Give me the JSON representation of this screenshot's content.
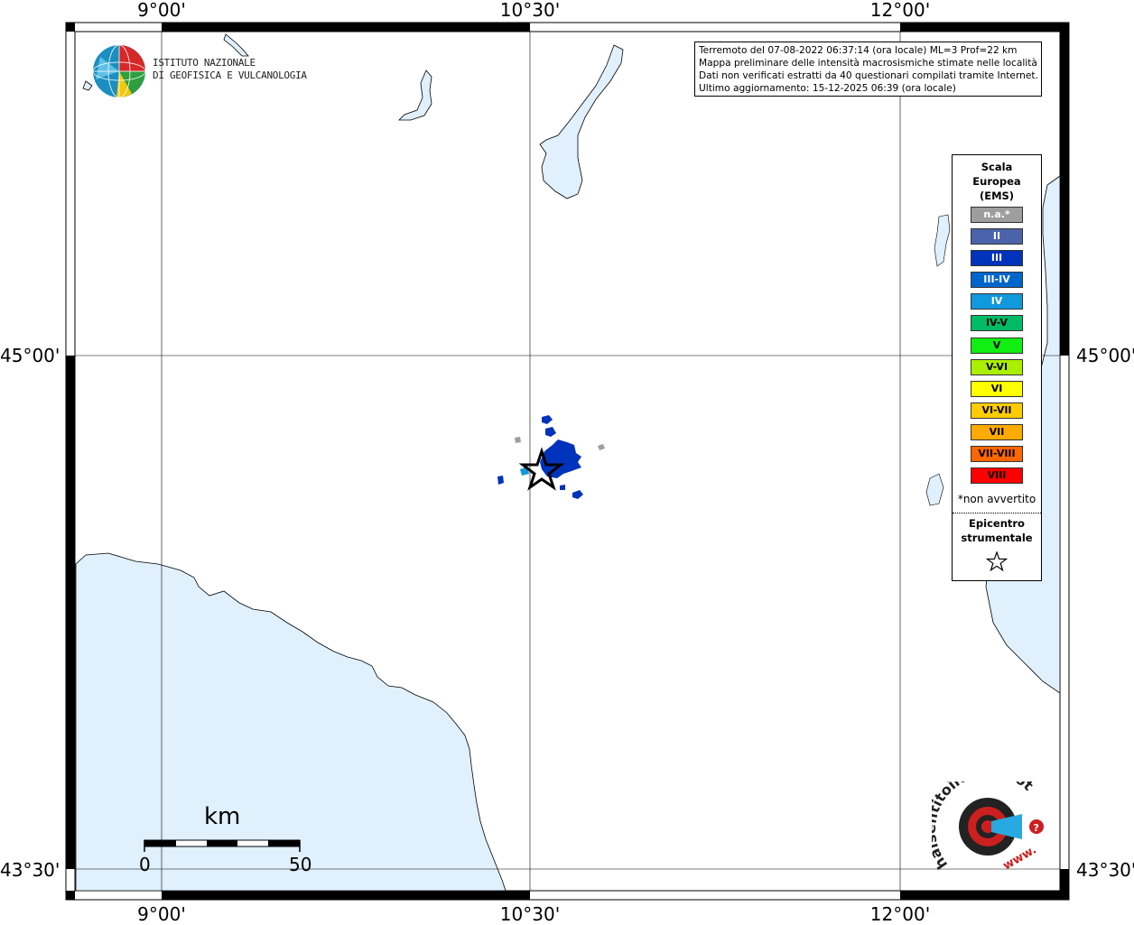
{
  "axes": {
    "top_labels": [
      "9°00'",
      "10°30'",
      "12°00'"
    ],
    "bottom_labels": [
      "9°00'",
      "10°30'",
      "12°00'"
    ],
    "left_labels": [
      "45°00'",
      "43°30'"
    ],
    "right_labels": [
      "45°00'",
      "43°30'"
    ]
  },
  "info": {
    "line1": "Terremoto del 07-08-2022 06:37:14 (ora locale) ML=3 Prof=22 km",
    "line2": "Mappa preliminare delle intensità macrosismiche stimate nelle località",
    "line3": "Dati non verificati estratti da 40 questionari compilati tramite Internet.",
    "line4": "Ultimo aggiornamento: 15-12-2025 06:39 (ora locale)"
  },
  "legend": {
    "title_line1": "Scala",
    "title_line2": "Europea",
    "title_line3": "(EMS)",
    "items": [
      {
        "label": "n.a.*",
        "color": "#9e9e9e"
      },
      {
        "label": "II",
        "color": "#4a63aa"
      },
      {
        "label": "III",
        "color": "#0033bb"
      },
      {
        "label": "III-IV",
        "color": "#0066cc"
      },
      {
        "label": "IV",
        "color": "#1199dd"
      },
      {
        "label": "IV-V",
        "color": "#00bb66"
      },
      {
        "label": "V",
        "color": "#11ee11"
      },
      {
        "label": "V-VI",
        "color": "#aaee00"
      },
      {
        "label": "VI",
        "color": "#ffff00"
      },
      {
        "label": "VI-VII",
        "color": "#ffcc00"
      },
      {
        "label": "VII",
        "color": "#ffaa00"
      },
      {
        "label": "VII-VIII",
        "color": "#ff6600"
      },
      {
        "label": "VIII",
        "color": "#ff0000"
      }
    ],
    "note": "*non avvertito",
    "epicenter_line1": "Epicentro",
    "epicenter_line2": "strumentale"
  },
  "logos": {
    "ingv_line1": "ISTITUTO NAZIONALE",
    "ingv_line2": "DI GEOFISICA E VULCANOLOGIA",
    "hsit_text": "haisentitoilterremoto.it",
    "hsit_www": "www."
  },
  "scale": {
    "unit": "km",
    "start": "0",
    "end": "50"
  },
  "colors": {
    "sea": "#e0f0fc",
    "land": "#ffffff",
    "intensity_dark": "#0033bb",
    "not_felt": "#9e9e9e"
  }
}
